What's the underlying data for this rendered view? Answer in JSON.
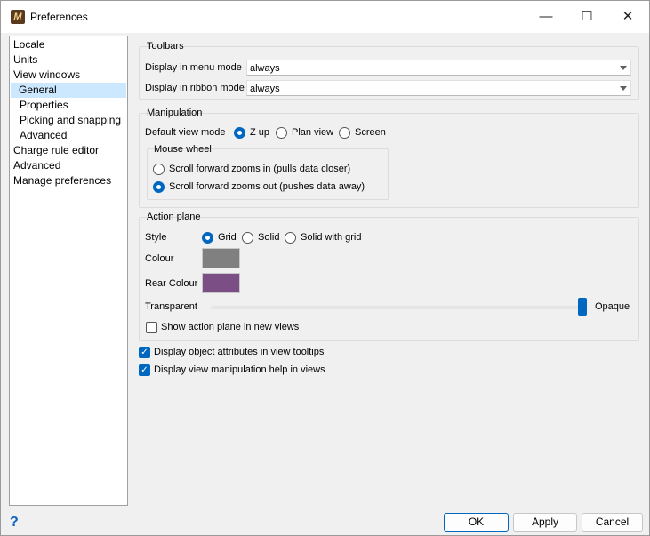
{
  "window": {
    "title": "Preferences",
    "app_icon": "app-logo-icon",
    "minimize": "—",
    "maximize": "☐",
    "close": "✕"
  },
  "sidebar": {
    "items": [
      {
        "label": "Locale"
      },
      {
        "label": "Units"
      },
      {
        "label": "View windows"
      },
      {
        "label": "General",
        "selected": true
      },
      {
        "label": "Properties"
      },
      {
        "label": "Picking and snapping"
      },
      {
        "label": "Advanced"
      },
      {
        "label": "Charge rule editor"
      },
      {
        "label": "Advanced"
      },
      {
        "label": "Manage preferences"
      }
    ]
  },
  "toolbars": {
    "group_label": "Toolbars",
    "menu_mode_label": "Display in menu mode",
    "menu_mode_value": "always",
    "ribbon_mode_label": "Display in ribbon mode",
    "ribbon_mode_value": "always"
  },
  "manipulation": {
    "group_label": "Manipulation",
    "default_view_label": "Default view mode",
    "options": [
      "Z up",
      "Plan view",
      "Screen"
    ],
    "selected": "Z up",
    "mouse_wheel": {
      "group_label": "Mouse wheel",
      "options": [
        "Scroll forward zooms in (pulls data closer)",
        "Scroll forward zooms out (pushes data away)"
      ],
      "selected": "Scroll forward zooms out (pushes data away)"
    }
  },
  "action_plane": {
    "group_label": "Action plane",
    "style_label": "Style",
    "style_options": [
      "Grid",
      "Solid",
      "Solid with grid"
    ],
    "style_selected": "Grid",
    "colour_label": "Colour",
    "colour_value": "#808080",
    "rear_colour_label": "Rear Colour",
    "rear_colour_value": "#7b4f86",
    "transparent_label": "Transparent",
    "opaque_label": "Opaque",
    "transparency_level": 1.0,
    "show_in_new_views_label": "Show action plane in new views",
    "show_in_new_views_checked": false
  },
  "options": {
    "display_attributes_label": "Display object attributes in view tooltips",
    "display_attributes_checked": true,
    "display_help_label": "Display view manipulation help in views",
    "display_help_checked": true
  },
  "footer": {
    "help": "?",
    "ok": "OK",
    "apply": "Apply",
    "cancel": "Cancel"
  }
}
